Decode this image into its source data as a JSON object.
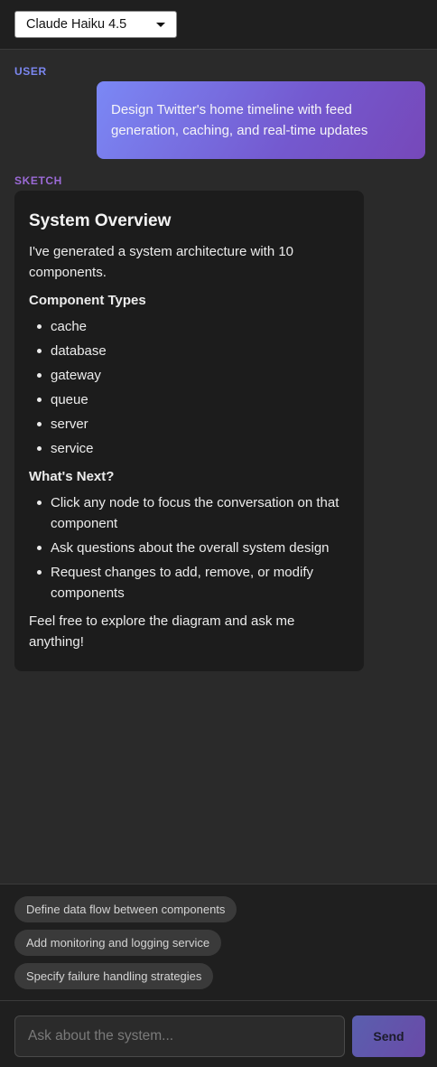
{
  "header": {
    "model_select": {
      "value": "Claude Haiku 4.5"
    }
  },
  "conversation": {
    "user_label": "USER",
    "user_message": "Design Twitter's home timeline with feed generation, caching, and real-time updates",
    "sketch_label": "SKETCH",
    "sketch": {
      "title": "System Overview",
      "intro": "I've generated a system architecture with 10 components.",
      "types_heading": "Component Types",
      "types": [
        "cache",
        "database",
        "gateway",
        "queue",
        "server",
        "service"
      ],
      "next_heading": "What's Next?",
      "next_items": [
        "Click any node to focus the conversation on that component",
        "Ask questions about the overall system design",
        "Request changes to add, remove, or modify components"
      ],
      "closing": "Feel free to explore the diagram and ask me anything!"
    }
  },
  "suggestions": [
    "Define data flow between components",
    "Add monitoring and logging service",
    "Specify failure handling strategies"
  ],
  "composer": {
    "placeholder": "Ask about the system...",
    "value": "",
    "send_label": "Send"
  },
  "colors": {
    "accent_user": "#7b87f0",
    "accent_sketch": "#9b6ad6",
    "background": "#2a2a2a"
  }
}
